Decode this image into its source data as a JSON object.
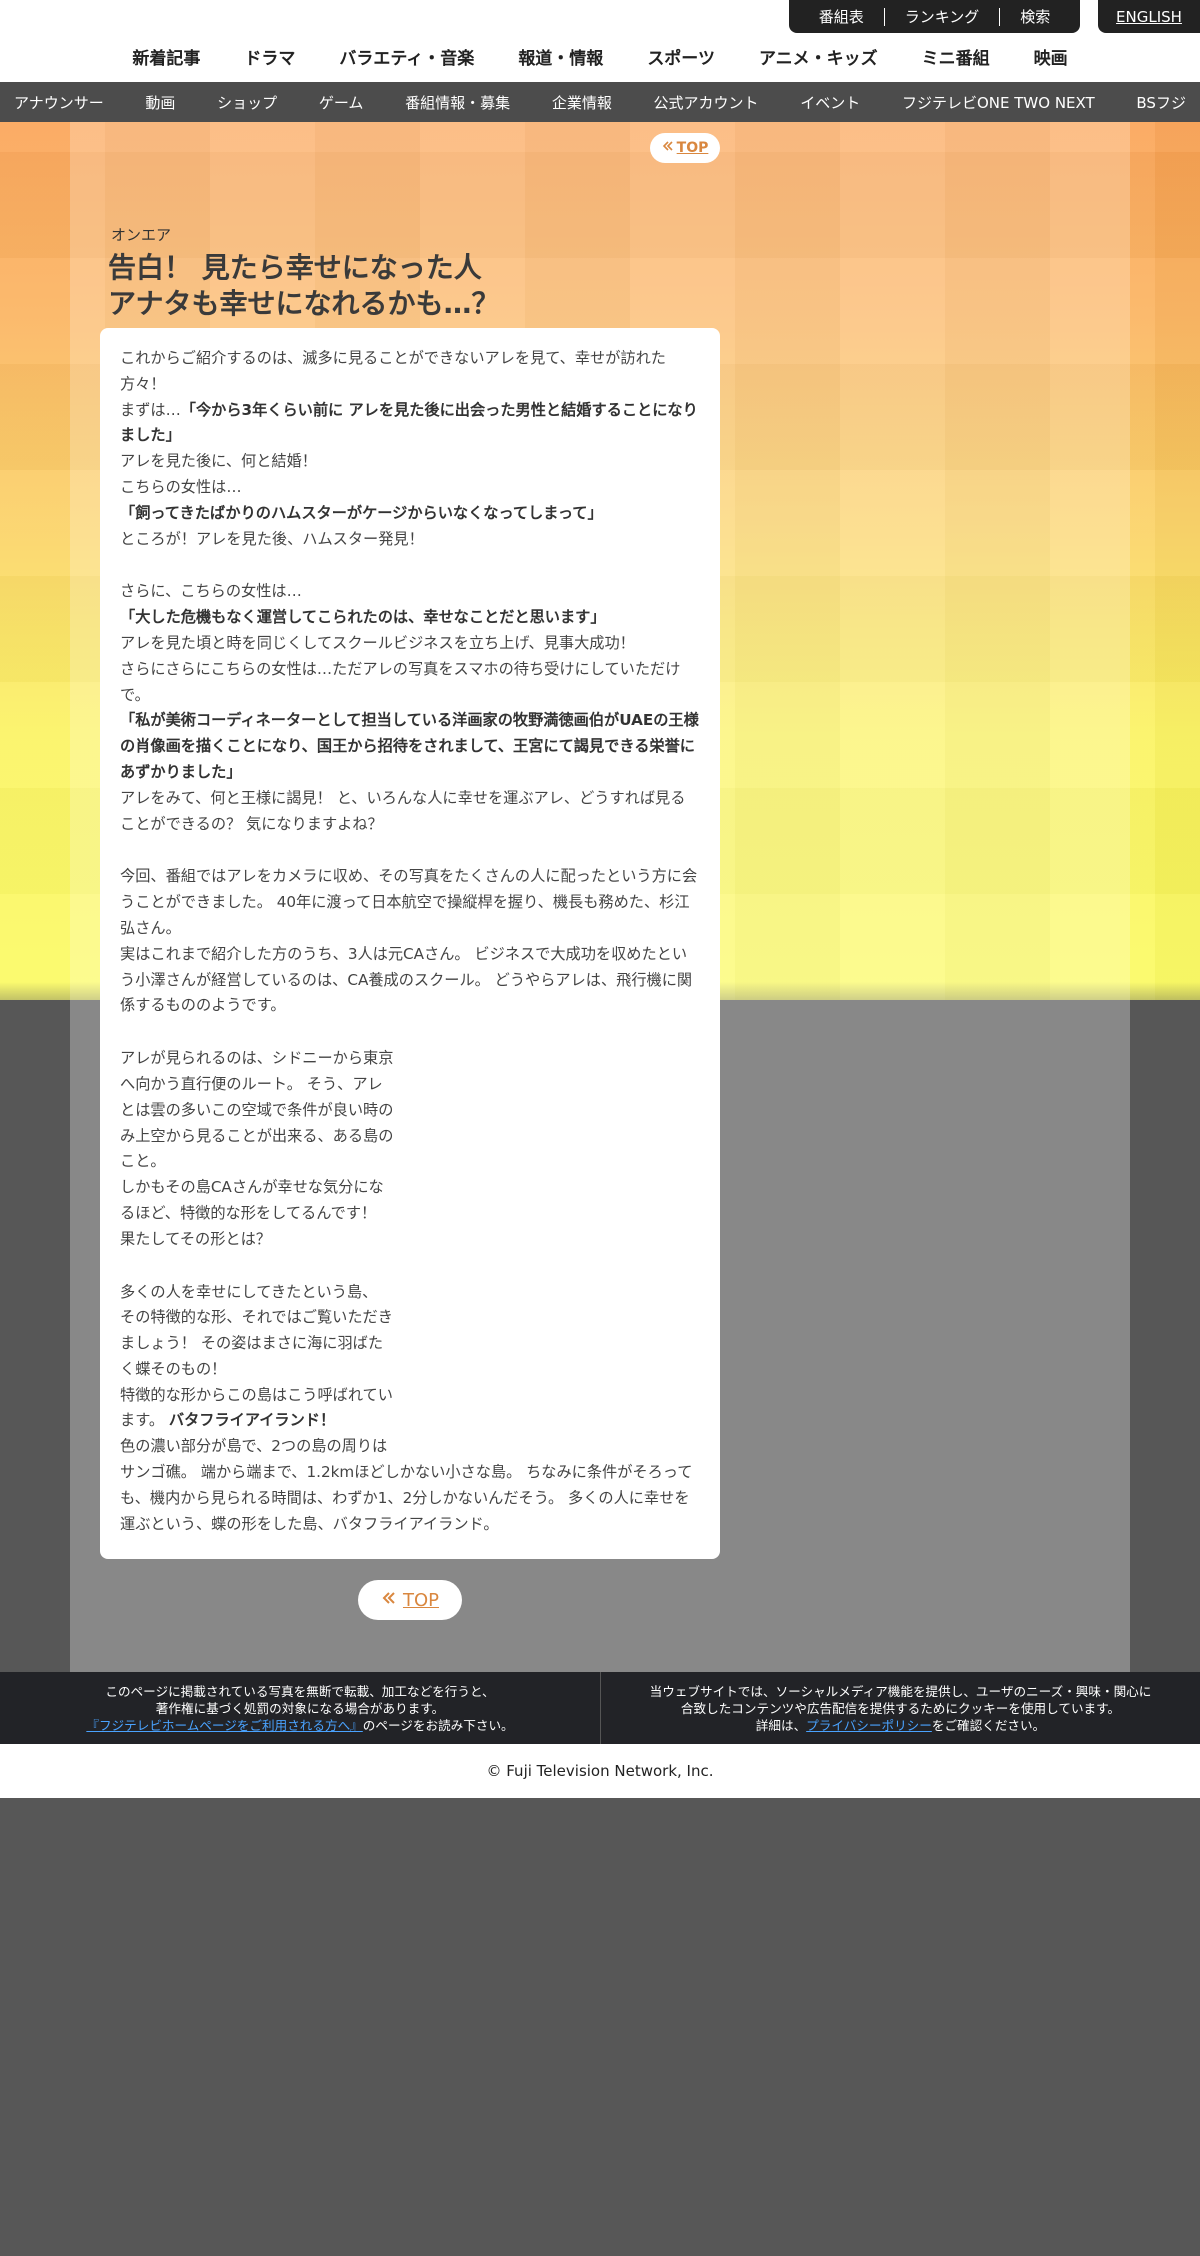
{
  "util_links": [
    "番組表",
    "ランキング",
    "検索"
  ],
  "english": "ENGLISH",
  "main_nav": [
    "新着記事",
    "ドラマ",
    "バラエティ・音楽",
    "報道・情報",
    "スポーツ",
    "アニメ・キッズ",
    "ミニ番組",
    "映画"
  ],
  "sub_nav": [
    "アナウンサー",
    "動画",
    "ショップ",
    "ゲーム",
    "番組情報・募集",
    "企業情報",
    "公式アカウント",
    "イベント",
    "フジテレビONE TWO NEXT",
    "BSフジ"
  ],
  "top_small": "TOP",
  "category": "オンエア",
  "title_line1": "告白！ 見たら幸せになった人",
  "title_line2": "アナタも幸せになれるかも…？",
  "body": {
    "p1": "これからご紹介するのは、滅多に見ることができないアレを見て、幸せが訪れた方々！",
    "p2_pre": "まずは…",
    "p2_bold": "「今から3年くらい前に アレを見た後に出会った男性と結婚することになりました」",
    "p3": "アレを見た後に、何と結婚！",
    "p4": "こちらの女性は…",
    "p5_bold": "「飼ってきたばかりのハムスターがケージからいなくなってしまって」",
    "p6": "ところが！アレを見た後、ハムスター発見！",
    "p7": "さらに、こちらの女性は…",
    "p8_bold": "「大した危機もなく運営してこられたのは、幸せなことだと思います」",
    "p9": "アレを見た頃と時を同じくしてスクールビジネスを立ち上げ、見事大成功！",
    "p10": "さらにさらにこちらの女性は…ただアレの写真をスマホの待ち受けにしていただけで。",
    "p11_bold": "「私が美術コーディネーターとして担当している洋画家の牧野満徳画伯がUAEの王様の肖像画を描くことになり、国王から招待をされまして、王宮にて謁見できる栄誉にあずかりました」",
    "p12": "アレをみて、何と王様に謁見！ と、いろんな人に幸せを運ぶアレ、どうすれば見ることができるの？ 気になりますよね？",
    "p13": "今回、番組ではアレをカメラに収め、その写真をたくさんの人に配ったという方に会うことができました。 40年に渡って日本航空で操縦桿を握り、機長も務めた、杉江弘さん。",
    "p14": "実はこれまで紹介した方のうち、3人は元CAさん。 ビジネスで大成功を収めたという小澤さんが経営しているのは、CA養成のスクール。 どうやらアレは、飛行機に関係するもののようです。",
    "p15": "アレが見られるのは、シドニーから東京へ向かう直行便のルート。 そう、アレとは雲の多いこの空域で条件が良い時のみ上空から見ることが出来る、ある島のこと。",
    "p16": "しかもその島CAさんが幸せな気分になるほど、特徴的な形をしてるんです！ 果たしてその形とは？",
    "p17": "多くの人を幸せにしてきたという島、 その特徴的な形、それではご覧いただきましょう！ その姿はまさに海に羽ばたく蝶そのもの！",
    "p18_pre": "特徴的な形からこの島はこう呼ばれています。 ",
    "p18_bold": "バタフライアイランド！",
    "p19a": "色の濃い部分が島で、2つの島の周りは",
    "p19b": "サンゴ礁。 端から端まで、1.2kmほどしかない小さな島。 ちなみに条件がそろっても、機内から見られる時間は、わずか1、2分しかないんだそう。 多くの人に幸せを運ぶという、蝶の形をした島、バタフライアイランド。"
  },
  "top_big": "TOP",
  "notice_left": {
    "line1": "このページに掲載されている写真を無断で転載、加工などを行うと、",
    "line2": "著作権に基づく処罰の対象になる場合があります。",
    "link": "『フジテレビホームページをご利用される方へ』",
    "line3_suffix": "のページをお読み下さい。"
  },
  "notice_right": {
    "line1": "当ウェブサイトでは、ソーシャルメディア機能を提供し、ユーザのニーズ・興味・関心に",
    "line2": "合致したコンテンツや広告配信を提供するためにクッキーを使用しています。",
    "line3_prefix": "詳細は、",
    "link": "プライバシーポリシー",
    "line3_suffix": "をご確認ください。"
  },
  "copyright": "© Fuji Television Network, Inc.",
  "colors": {
    "accent": "#d9873f",
    "nav_dark": "#222222",
    "subnav": "#4c4c4c",
    "link_blue": "#4aa3ff"
  }
}
